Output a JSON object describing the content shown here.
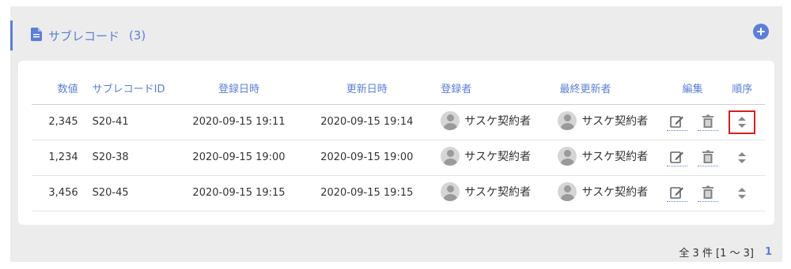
{
  "section": {
    "title": "サブレコード",
    "count": "(3)"
  },
  "columns": [
    "数値",
    "サブレコードID",
    "登録日時",
    "更新日時",
    "登録者",
    "最終更新者",
    "編集",
    "順序"
  ],
  "rows": [
    {
      "value": "2,345",
      "id": "S20-41",
      "registered": "2020-09-15 19:11",
      "updated": "2020-09-15 19:14",
      "registrant": "サスケ契約者",
      "updater": "サスケ契約者"
    },
    {
      "value": "1,234",
      "id": "S20-38",
      "registered": "2020-09-15 19:00",
      "updated": "2020-09-15 19:00",
      "registrant": "サスケ契約者",
      "updater": "サスケ契約者"
    },
    {
      "value": "3,456",
      "id": "S20-45",
      "registered": "2020-09-15 19:15",
      "updated": "2020-09-15 19:15",
      "registrant": "サスケ契約者",
      "updater": "サスケ契約者"
    }
  ],
  "pagination": {
    "summary": "全 3 件 [1 ～ 3]",
    "current_page": "1"
  },
  "colors": {
    "accent": "#5b7fd6",
    "highlight": "#d32020",
    "panel_bg": "#ececec"
  },
  "icons": {
    "section": "document-icon",
    "add": "plus-circle-icon",
    "edit": "edit-icon",
    "delete": "trash-icon",
    "order": "sort-icon"
  }
}
